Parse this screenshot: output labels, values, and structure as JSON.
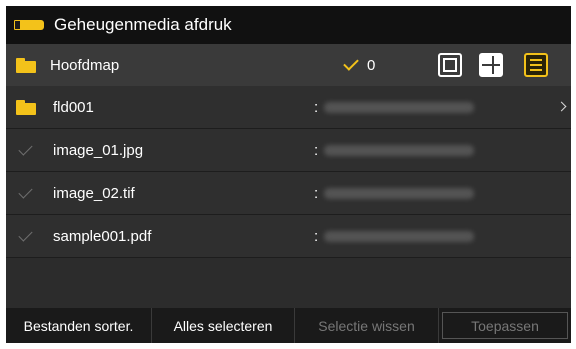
{
  "header": {
    "title": "Geheugenmedia afdruk",
    "icon": "memory-media-icon",
    "accent_color": "#f3c21a"
  },
  "pathbar": {
    "folder_name": "Hoofdmap",
    "selected_count": "0",
    "view_modes": [
      "single-view-icon",
      "grid-view-icon",
      "list-view-icon"
    ],
    "active_view": "list-view-icon"
  },
  "files": [
    {
      "type": "folder",
      "name": "fld001",
      "separator": ":",
      "date_hidden": true,
      "has_chevron": true
    },
    {
      "type": "file",
      "name": "image_01.jpg",
      "separator": ":",
      "date_hidden": true,
      "has_chevron": false
    },
    {
      "type": "file",
      "name": "image_02.tif",
      "separator": ":",
      "date_hidden": true,
      "has_chevron": false
    },
    {
      "type": "file",
      "name": "sample001.pdf",
      "separator": ":",
      "date_hidden": true,
      "has_chevron": false
    }
  ],
  "bottom": {
    "sort_label": "Bestanden sorter.",
    "select_all_label": "Alles selecteren",
    "clear_label": "Selectie wissen",
    "apply_label": "Toepassen"
  }
}
